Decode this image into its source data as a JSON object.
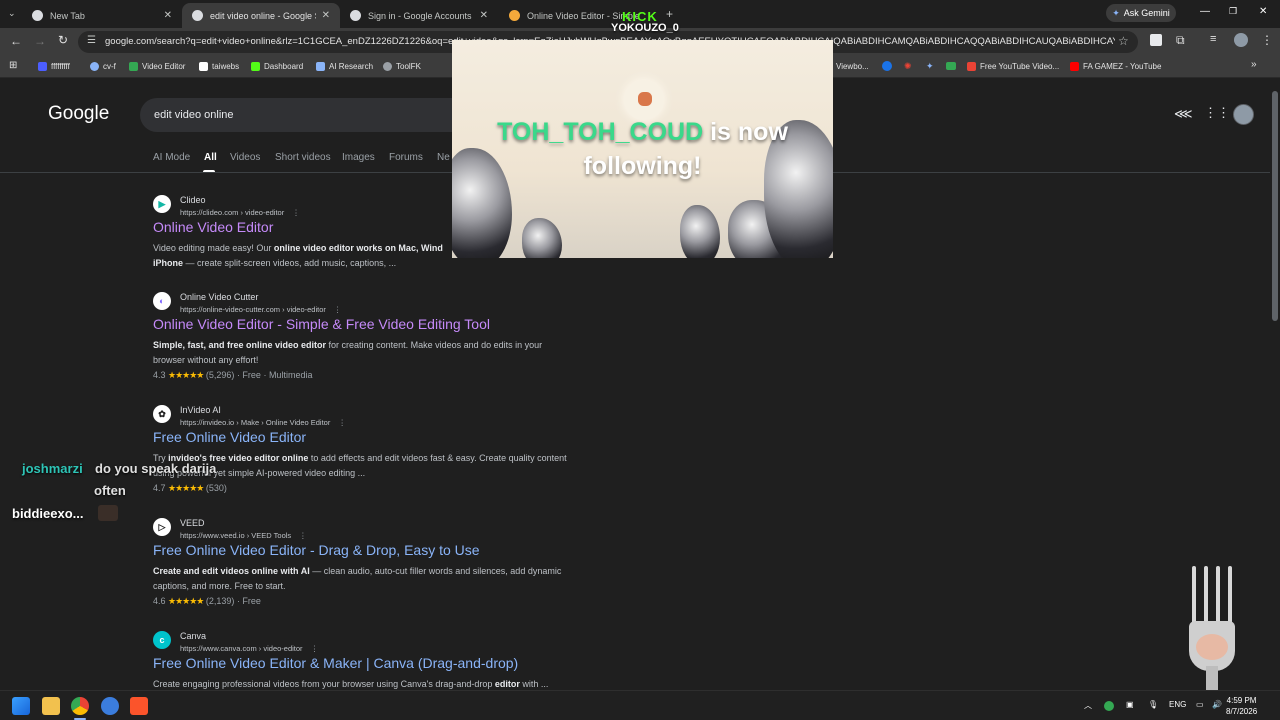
{
  "browser": {
    "tabs": [
      {
        "title": "New Tab",
        "active": false
      },
      {
        "title": "edit video online - Google Search",
        "active": true
      },
      {
        "title": "Sign in - Google Accounts",
        "active": false
      },
      {
        "title": "Online Video Editor - Simple",
        "active": false
      }
    ],
    "new_tab": "+",
    "ask_gemini": "Ask Gemini",
    "url": "google.com/search?q=edit+video+online&rlz=1C1GCEA_enDZ1226DZ1226&oq=edit+video&gs_lcrp=EgZjaHJvbWUqBwgBEAAYgAQyBggAEEUYOTIHCAEQABiABDIHCAIQABiABDIHCAMQABiABDIHCAQQABiABDIHCAUQABiABDIHCAYQABiABD..."
  },
  "bookmarks": [
    {
      "label": "fffffffff",
      "color": "#4c5eff"
    },
    {
      "label": "cv-f",
      "color": "#8ab4f8"
    },
    {
      "label": "Video Editor",
      "color": "#34a853"
    },
    {
      "label": "taiwebs",
      "color": "#ffffff"
    },
    {
      "label": "Dashboard",
      "color": "#53fc18"
    },
    {
      "label": "AI Research",
      "color": "#8ab4f8"
    },
    {
      "label": "ToolFK",
      "color": "#9aa0a6"
    },
    {
      "label": "Viewbo...",
      "color": "#e8eaed"
    },
    {
      "label": "Free YouTube Video...",
      "color": "#ea4335"
    },
    {
      "label": "FA GAMEZ - YouTube",
      "color": "#ff0000"
    }
  ],
  "google": {
    "logo": "Google",
    "query": "edit video online",
    "nav_tabs": [
      "AI Mode",
      "All",
      "Videos",
      "Short videos",
      "Images",
      "Forums",
      "Ne"
    ],
    "results": [
      {
        "site": "Clideo",
        "cite": "https://clideo.com › video-editor",
        "title": "Online Video Editor",
        "visited": true,
        "snippet_pre": "Video editing made easy! Our ",
        "snippet_bold": "online video editor works on Mac, Wind",
        "snippet_post": "",
        "snippet_line2_bold": "iPhone",
        "snippet_line2": " — create split-screen videos, add music, captions, ...",
        "rating": ""
      },
      {
        "site": "Online Video Cutter",
        "cite": "https://online-video-cutter.com › video-editor",
        "title": "Online Video Editor - Simple & Free Video Editing Tool",
        "visited": true,
        "snippet_pre": "",
        "snippet_bold": "Simple, fast, and free online video editor",
        "snippet_post": " for creating content. Make videos and do edits in your",
        "snippet_line2_bold": "",
        "snippet_line2": "browser without any effort!",
        "rating_value": "4.3",
        "rating_count": "(5,296)",
        "rating_extra": "· Free · Multimedia"
      },
      {
        "site": "InVideo AI",
        "cite": "https://invideo.io › Make › Online Video Editor",
        "title": "Free Online Video Editor",
        "visited": false,
        "snippet_pre": "Try ",
        "snippet_bold": "invideo's free video editor online",
        "snippet_post": " to add effects and edit videos fast & easy. Create quality content",
        "snippet_line2_bold": "",
        "snippet_line2": "using powerful yet simple AI-powered video editing ...",
        "rating_value": "4.7",
        "rating_count": "(530)",
        "rating_extra": ""
      },
      {
        "site": "VEED",
        "cite": "https://www.veed.io › VEED Tools",
        "title": "Free Online Video Editor - Drag & Drop, Easy to Use",
        "visited": false,
        "snippet_pre": "",
        "snippet_bold": "Create and edit videos online with AI",
        "snippet_post": " — clean audio, auto-cut filler words and silences, add dynamic",
        "snippet_line2_bold": "",
        "snippet_line2": "captions, and more. Free to start.",
        "rating_value": "4.6",
        "rating_count": "(2,139)",
        "rating_extra": "· Free"
      },
      {
        "site": "Canva",
        "cite": "https://www.canva.com › video-editor",
        "title": "Free Online Video Editor & Maker | Canva (Drag-and-drop)",
        "visited": false,
        "snippet_pre": "Create engaging professional videos from your browser using Canva's drag-and-drop ",
        "snippet_bold": "editor",
        "snippet_post": " with ...",
        "snippet_line2_bold": "",
        "snippet_line2": "",
        "rating": ""
      }
    ]
  },
  "stream_overlay": {
    "kick_logo": "KICK",
    "kick_user": "YOKOUZO_0",
    "follower_name": "TOH_TOH_COUD",
    "line1_rest": " is now",
    "line2": "following!"
  },
  "chat": [
    {
      "user": "joshmarzi",
      "message": "do you speak darija",
      "message_cont": "often",
      "user_color": "#2ec4b6"
    },
    {
      "user": "biddieexo...",
      "message": "",
      "user_color": "#ffffff"
    }
  ],
  "stars": "★★★★★",
  "taskbar": {
    "language": "ENG",
    "time": "4:59 PM",
    "date": "8/7/2026"
  }
}
